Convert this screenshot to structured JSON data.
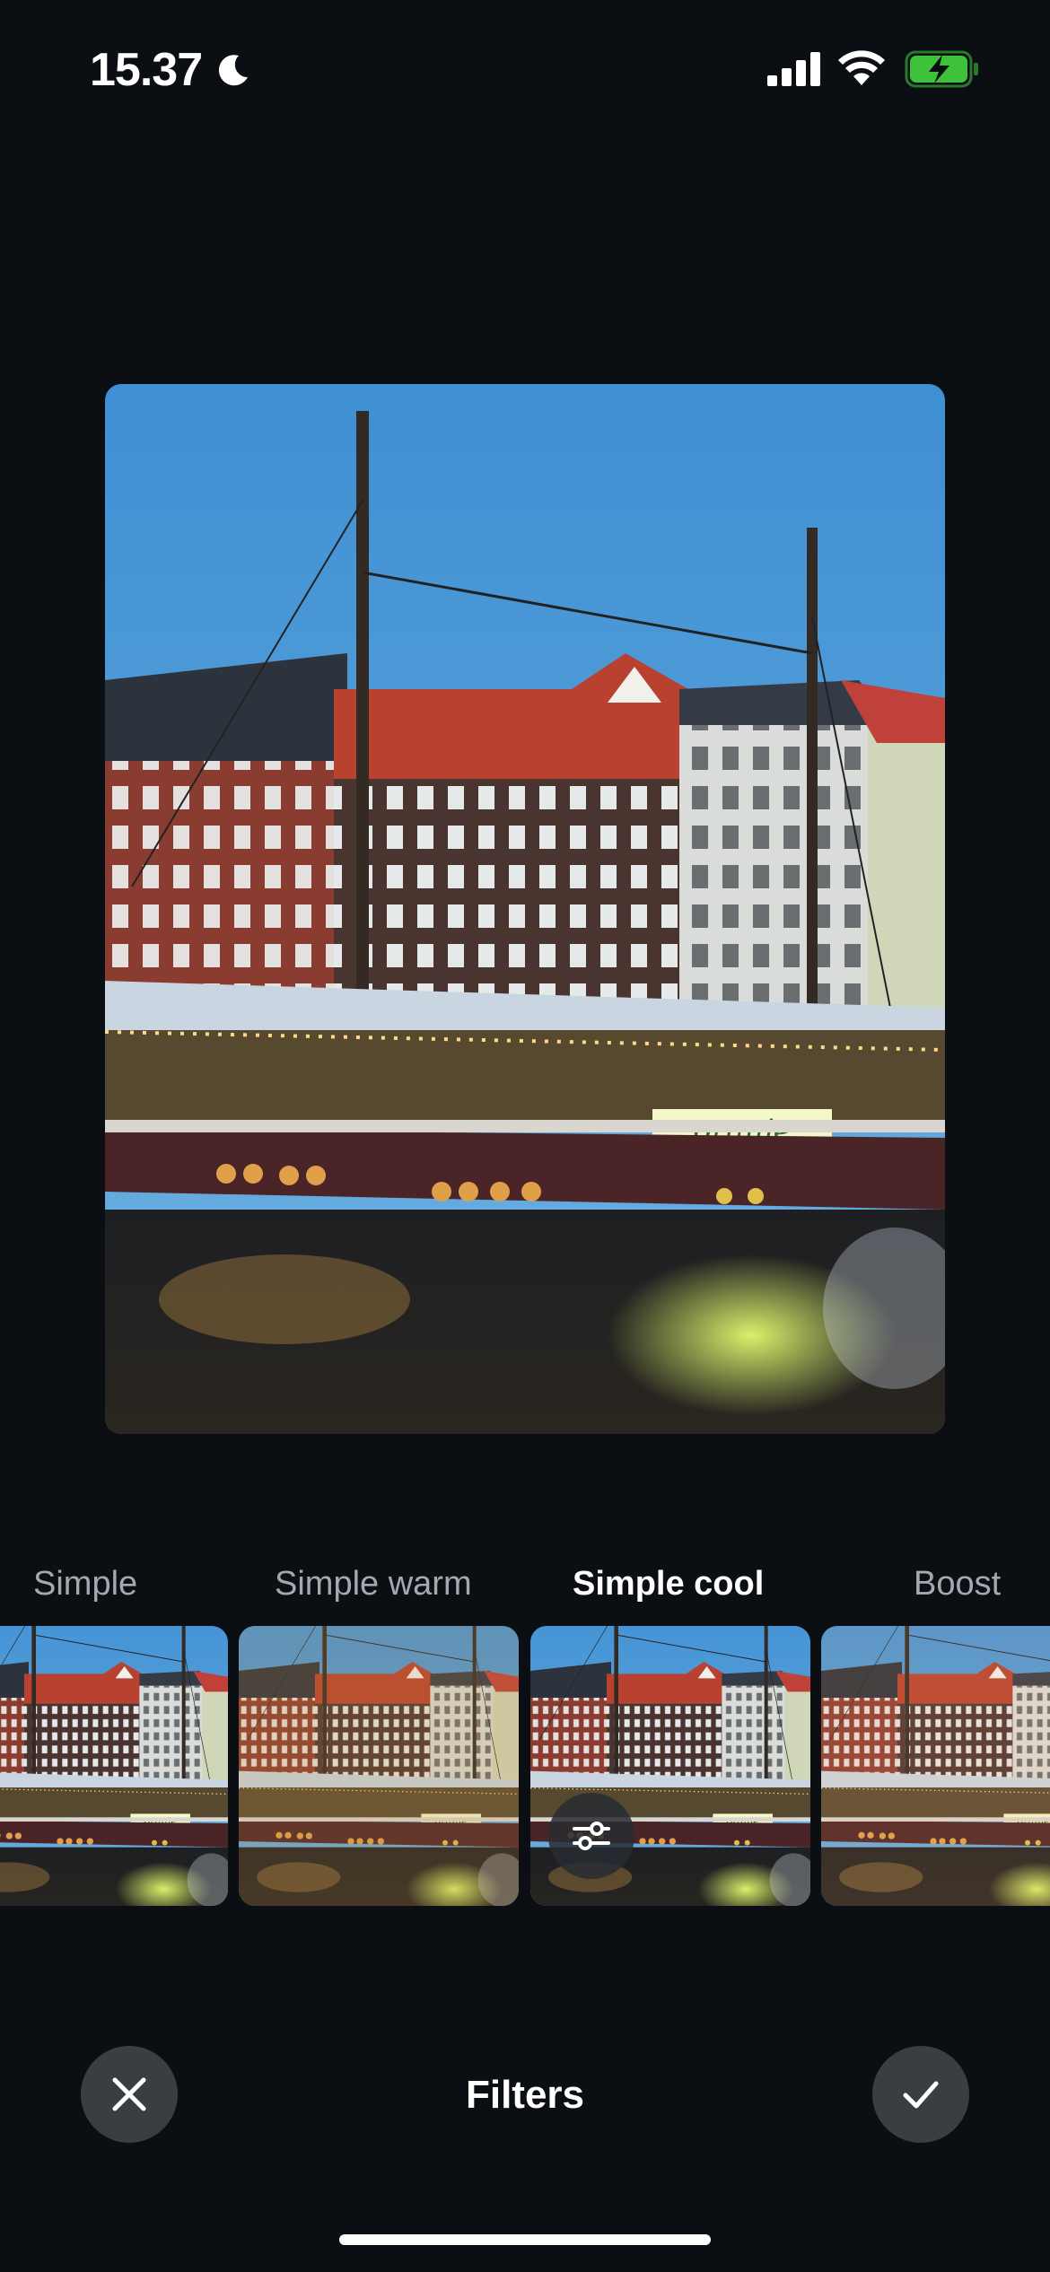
{
  "status_bar": {
    "time": "15.37",
    "icons": [
      "moon-icon",
      "cellular-signal-icon",
      "wifi-icon",
      "battery-charging-icon"
    ],
    "battery_color": "#3ec23a"
  },
  "photo": {
    "sign_text": "oranje"
  },
  "filters": {
    "items": [
      {
        "label": "Simple",
        "selected": false
      },
      {
        "label": "Simple warm",
        "selected": false
      },
      {
        "label": "Simple cool",
        "selected": true
      },
      {
        "label": "Boost",
        "selected": false
      }
    ],
    "adjust_icon": "sliders-icon"
  },
  "bottom_bar": {
    "title": "Filters",
    "cancel_icon": "close-icon",
    "confirm_icon": "checkmark-icon"
  },
  "colors": {
    "background": "#0b0e13",
    "button_bg": "#3a3d42",
    "label_inactive": "#a4a9b0"
  }
}
